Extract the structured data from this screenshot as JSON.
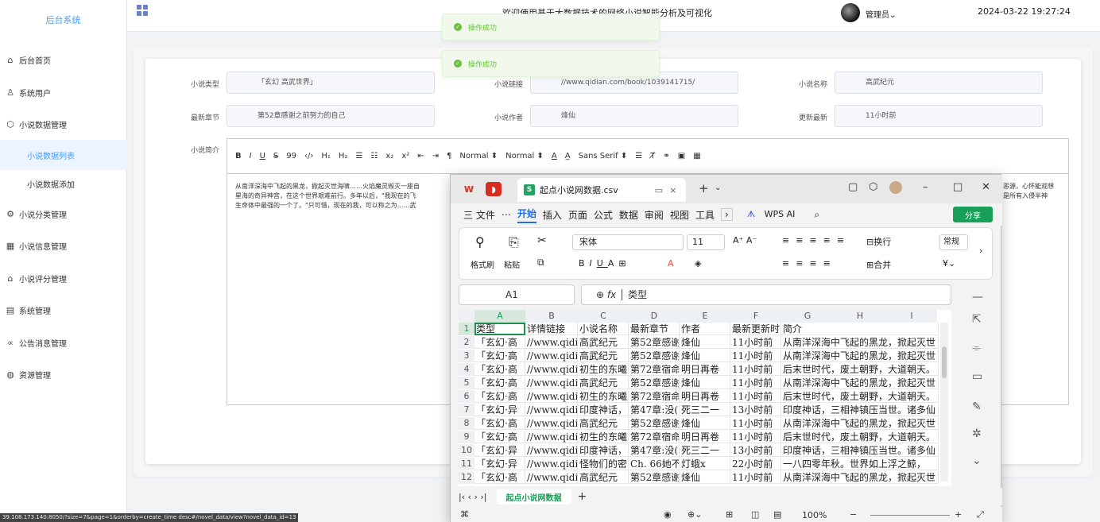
{
  "app": {
    "title": "后台系统",
    "header_title": "欢迎使用基于大数据技术的网络小说智能分析及可视化",
    "user": "管理员",
    "datetime": "2024-03-22 19:27:24"
  },
  "menu": [
    {
      "label": "后台首页",
      "icon": "home-icon"
    },
    {
      "label": "系统用户",
      "icon": "user-icon"
    },
    {
      "label": "小说数据管理",
      "icon": "cube-icon"
    },
    {
      "label": "小说数据列表",
      "icon": ""
    },
    {
      "label": "小说数据添加",
      "icon": ""
    },
    {
      "label": "小说分类管理",
      "icon": "gear-icon"
    },
    {
      "label": "小说信息管理",
      "icon": "grid-icon"
    },
    {
      "label": "小说评分管理",
      "icon": "building-icon"
    },
    {
      "label": "系统管理",
      "icon": "table-icon"
    },
    {
      "label": "公告消息管理",
      "icon": "share-icon"
    },
    {
      "label": "资源管理",
      "icon": "chat-icon"
    }
  ],
  "toasts": [
    "操作成功",
    "操作成功"
  ],
  "form": {
    "type_label": "小说类型",
    "type_value": "「玄幻 高武世界」",
    "link_label": "小说链接",
    "link_value": "//www.qidian.com/book/1039141715/",
    "name_label": "小说名称",
    "name_value": "高武纪元",
    "chapter_label": "最新章节",
    "chapter_value": "第52章感谢之前努力的自己",
    "author_label": "小说作者",
    "author_value": "烽仙",
    "update_label": "更新最新",
    "update_value": "11小时前",
    "intro_label": "小说简介",
    "toolbar": {
      "normal1": "Normal",
      "normal2": "Normal",
      "font": "Sans Serif"
    },
    "intro_line1": "从南洋深海中飞起的黑龙，掀起灭世海啸……火焰魔灵毁灭一座自",
    "intro_line2": "星海的奇异神宫，在这个世界艰难前行。多年以后，\"我现在的飞",
    "intro_line3": "生命体中最强的一个了。\"只可惜，现在的我，可以称之为……武",
    "intro_right1": "恶源，心怀能观想",
    "intro_right2": "是所有入侵半神"
  },
  "status_url": "39.108.173.140:8050/?size=7&page=1&orderby=create_time desc#/novel_data/view?novel_data_id=13",
  "wps": {
    "tab_title": "起点小说网数据.csv",
    "menus": [
      "三 文件",
      "⋯",
      "开始",
      "插入",
      "页面",
      "公式",
      "数据",
      "审阅",
      "视图",
      "工具"
    ],
    "wps_ai": "WPS AI",
    "share": "分享",
    "font_name": "宋体",
    "font_size": "11",
    "number_format": "常规",
    "labels": {
      "format_painter": "格式刷",
      "paste": "粘贴",
      "wrap": "换行",
      "merge": "合并"
    },
    "cell_ref": "A1",
    "formula": "类型",
    "fx": "fx",
    "sheet_tab": "起点小说网数据",
    "zoom": "100%",
    "columns": [
      "A",
      "B",
      "C",
      "D",
      "E",
      "F",
      "G",
      "H",
      "I"
    ],
    "rows": [
      [
        "类型",
        "详情链接",
        "小说名称",
        "最新章节",
        "作者",
        "最新更新时",
        "简介"
      ],
      [
        "「玄幻·高",
        "//www.qidi",
        "高武纪元",
        "第52章感谢",
        "烽仙",
        "11小时前",
        "从南洋深海中飞起的黑龙，掀起灭世"
      ],
      [
        "「玄幻·高",
        "//www.qidi",
        "高武纪元",
        "第52章感谢",
        "烽仙",
        "11小时前",
        "从南洋深海中飞起的黑龙，掀起灭世"
      ],
      [
        "「玄幻·高",
        "//www.qidi",
        "初生的东曦",
        "第72章宿命",
        "明日再卷",
        "11小时前",
        "后末世时代，废土朝野，大道朝天。"
      ],
      [
        "「玄幻·高",
        "//www.qidi",
        "高武纪元",
        "第52章感谢",
        "烽仙",
        "11小时前",
        "从南洋深海中飞起的黑龙，掀起灭世"
      ],
      [
        "「玄幻·高",
        "//www.qidi",
        "初生的东曦",
        "第72章宿命",
        "明日再卷",
        "11小时前",
        "后末世时代，废土朝野，大道朝天。"
      ],
      [
        "「玄幻·异",
        "//www.qidi",
        "印度神话，",
        "第47章:没(",
        "死三二一",
        "13小时前",
        "印度神话，三相神镇压当世。诸多仙"
      ],
      [
        "「玄幻·高",
        "//www.qidi",
        "高武纪元",
        "第52章感谢",
        "烽仙",
        "11小时前",
        "从南洋深海中飞起的黑龙，掀起灭世"
      ],
      [
        "「玄幻·高",
        "//www.qidi",
        "初生的东曦",
        "第72章宿命",
        "明日再卷",
        "11小时前",
        "后末世时代，废土朝野，大道朝天。"
      ],
      [
        "「玄幻·异",
        "//www.qidi",
        "印度神话，",
        "第47章:没(",
        "死三二一",
        "13小时前",
        "印度神话，三相神镇压当世。诸多仙"
      ],
      [
        "「玄幻·异",
        "//www.qidi",
        "怪物们的密",
        "Ch. 66她不",
        "灯蛾x",
        "22小时前",
        "一八四零年秋。世界如上浮之鲸，"
      ],
      [
        "「玄幻·高",
        "//www.qidi",
        "高武纪元",
        "第52章感谢",
        "烽仙",
        "11小时前",
        "从南洋深海中飞起的黑龙，掀起灭世"
      ]
    ]
  }
}
